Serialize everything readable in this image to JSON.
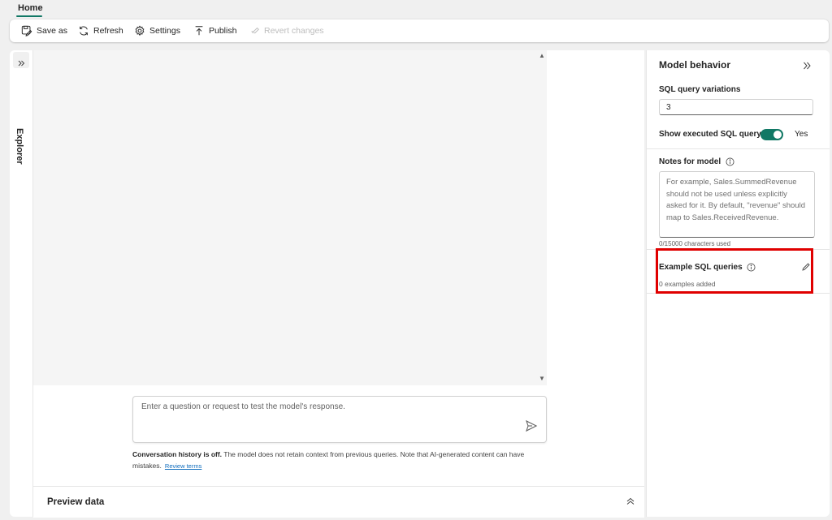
{
  "tabs": {
    "home": "Home"
  },
  "toolbar": {
    "save_as": "Save as",
    "refresh": "Refresh",
    "settings": "Settings",
    "publish": "Publish",
    "revert": "Revert changes"
  },
  "explorer": {
    "label": "Explorer"
  },
  "chat": {
    "placeholder": "Enter a question or request to test the model's response.",
    "disclaimer_bold": "Conversation history is off.",
    "disclaimer_text": " The model does not retain context from previous queries. Note that AI-generated content can have mistakes.",
    "review_link": "Review terms"
  },
  "preview": {
    "title": "Preview data"
  },
  "model_behavior": {
    "title": "Model behavior",
    "sql_variations_label": "SQL query variations",
    "sql_variations_value": "3",
    "show_sql_label": "Show executed SQL query",
    "show_sql_state": "Yes",
    "notes_label": "Notes for model",
    "notes_placeholder": "For example, Sales.SummedRevenue should not be used unless explicitly asked for it. By default, \"revenue\" should map to Sales.ReceivedRevenue.",
    "char_count": "0/15000 characters used",
    "examples_label": "Example SQL queries",
    "examples_count": "0 examples added"
  },
  "colors": {
    "accent": "#117865",
    "highlight": "#e00000",
    "link": "#0f6cbd"
  }
}
